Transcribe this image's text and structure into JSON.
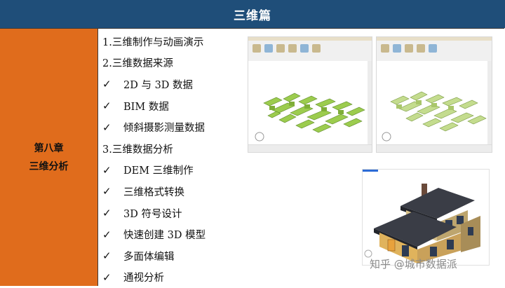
{
  "header": {
    "title": "三维篇"
  },
  "chapter": {
    "number": "第八章",
    "title": "三维分析"
  },
  "outline": [
    {
      "type": "heading",
      "text": "1.三维制作与动画演示"
    },
    {
      "type": "heading",
      "text": "2.三维数据来源"
    },
    {
      "type": "sub",
      "check": "✓",
      "text": "2D 与 3D 数据"
    },
    {
      "type": "sub",
      "check": "✓",
      "text": "BIM 数据"
    },
    {
      "type": "sub",
      "check": "✓",
      "text": "倾斜摄影测量数据"
    },
    {
      "type": "heading",
      "text": "3.三维数据分析"
    },
    {
      "type": "sub",
      "check": "✓",
      "text": "DEM 三维制作"
    },
    {
      "type": "sub",
      "check": "✓",
      "text": "三维格式转换"
    },
    {
      "type": "sub",
      "check": "✓",
      "text": "3D 符号设计"
    },
    {
      "type": "sub",
      "check": "✓",
      "text": "快速创建 3D 模型"
    },
    {
      "type": "sub",
      "check": "✓",
      "text": "多面体编辑"
    },
    {
      "type": "sub",
      "check": "✓",
      "text": "通视分析"
    }
  ],
  "watermark": {
    "text": "知乎 @城市数据派"
  },
  "colors": {
    "header_bg": "#1f4e79",
    "chapter_bg": "#e06c1c",
    "building_green": "#9ccc4e"
  }
}
